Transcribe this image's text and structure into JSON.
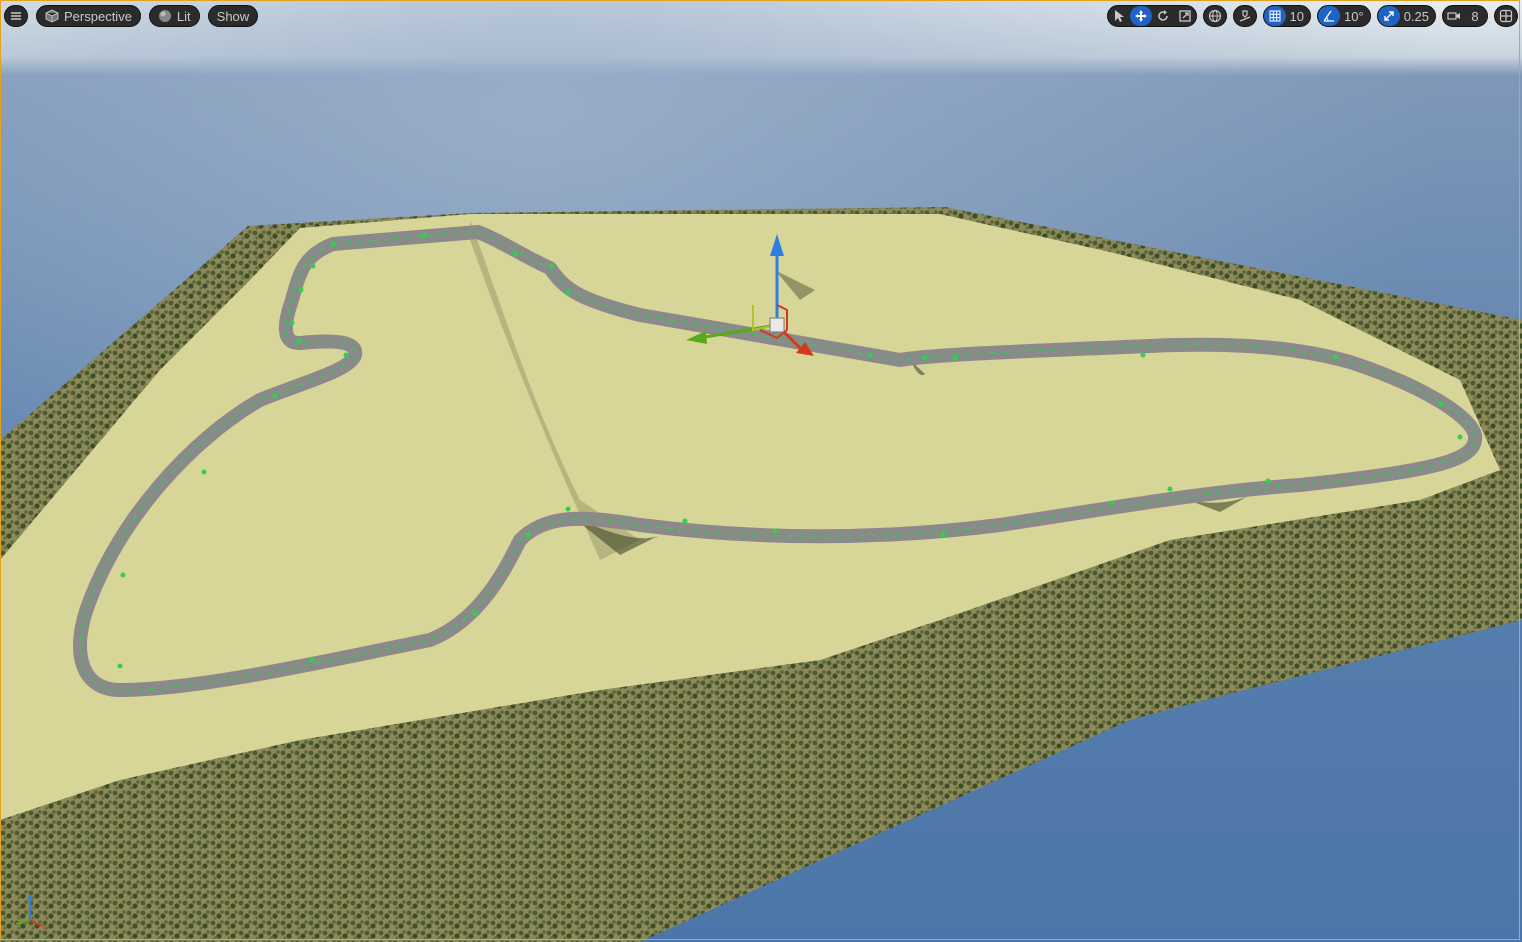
{
  "viewport": {
    "menu_icon": "hamburger-icon",
    "view_mode": {
      "icon": "cube-icon",
      "label": "Perspective"
    },
    "lighting": {
      "icon": "sphere-icon",
      "label": "Lit"
    },
    "show": {
      "label": "Show"
    }
  },
  "transform_tools": {
    "select": "cursor-icon",
    "translate": "move-icon",
    "rotate": "rotate-icon",
    "scale": "scale-icon",
    "active": "translate"
  },
  "coordinate_space": "globe-icon",
  "surface_snapping": "snap-surface-icon",
  "grid_snap": {
    "icon": "grid-icon",
    "value": "10"
  },
  "rotation_snap": {
    "icon": "angle-icon",
    "value": "10°"
  },
  "scale_snap": {
    "icon": "scale-arrow-icon",
    "value": "0.25"
  },
  "camera_speed": {
    "icon": "camera-icon",
    "value": "8"
  },
  "layout": "layout-icon",
  "colors": {
    "sky": "#4f7cb0",
    "terrain": "#d9d79a",
    "road": "#8a8a8a",
    "spline": "#3ec05a",
    "gizmo_x": "#d23a1e",
    "gizmo_y": "#5aa81c",
    "gizmo_z": "#2f7ee0",
    "accent": "#1f63c4"
  }
}
